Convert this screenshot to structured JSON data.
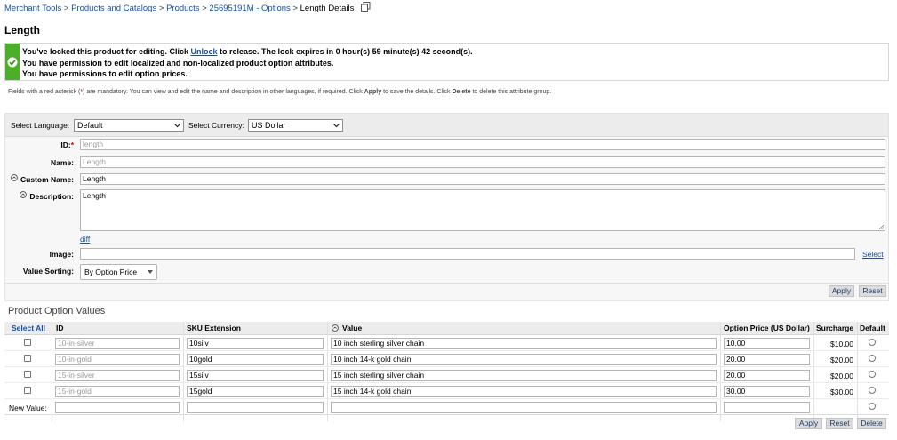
{
  "breadcrumb": {
    "items": [
      "Merchant Tools",
      "Products and Catalogs",
      "Products",
      "25695191M - Options"
    ],
    "current": "Length Details",
    "separator": ">"
  },
  "page": {
    "title": "Length"
  },
  "messages": {
    "line1_before": "You've locked this product for editing. Click ",
    "line1_link": "Unlock",
    "line1_after": " to release. The lock expires in 0 hour(s) 59 minute(s) 42 second(s).",
    "line2": "You have permission to edit localized and non-localized product option attributes.",
    "line3": "You have permissions to edit option prices."
  },
  "hint": {
    "part1": "Fields with a red asterisk (",
    "asterisk": "*",
    "part2": ") are mandatory. You can view and edit the name and description in other languages, if required. Click ",
    "apply": "Apply",
    "part3": " to save the details. Click ",
    "delete": "Delete",
    "part4": " to delete this attribute group."
  },
  "form": {
    "language_label": "Select Language:",
    "language_value": "Default",
    "currency_label": "Select Currency:",
    "currency_value": "US Dollar",
    "id_label": "ID:",
    "id_required": "*",
    "id_value": "length",
    "name_label": "Name:",
    "name_placeholder": "Length",
    "custom_name_label": "Custom Name:",
    "custom_name_value": "Length",
    "description_label": "Description:",
    "description_value": "Length",
    "diff_link": "diff",
    "image_label": "Image:",
    "image_value": "",
    "select_link": "Select",
    "value_sorting_label": "Value Sorting:",
    "value_sorting_value": "By Option Price",
    "apply_label": "Apply",
    "reset_label": "Reset"
  },
  "values_section": {
    "title": "Product Option Values",
    "columns": {
      "select_all": "Select All",
      "id": "ID",
      "sku": "SKU Extension",
      "value": "Value",
      "price": "Option Price (US Dollar)",
      "surcharge": "Surcharge",
      "default": "Default"
    },
    "rows": [
      {
        "id": "10-in-silver",
        "sku": "10silv",
        "value": "10 inch sterling silver chain",
        "price": "10.00",
        "surcharge": "$10.00"
      },
      {
        "id": "10-in-gold",
        "sku": "10gold",
        "value": "10  inch 14-k gold chain",
        "price": "20.00",
        "surcharge": "$20.00"
      },
      {
        "id": "15-in-silver",
        "sku": "15silv",
        "value": "15 inch sterling silver chain",
        "price": "20.00",
        "surcharge": "$20.00"
      },
      {
        "id": "15-in-gold",
        "sku": "15gold",
        "value": "15 inch 14-k gold chain",
        "price": "30.00",
        "surcharge": "$30.00"
      }
    ],
    "new_value_label": "New Value:",
    "apply_label": "Apply",
    "reset_label": "Reset",
    "delete_label": "Delete"
  },
  "colors": {
    "link": "#1a4f9c",
    "success_flag": "#4caf28",
    "required": "#dd0000"
  }
}
